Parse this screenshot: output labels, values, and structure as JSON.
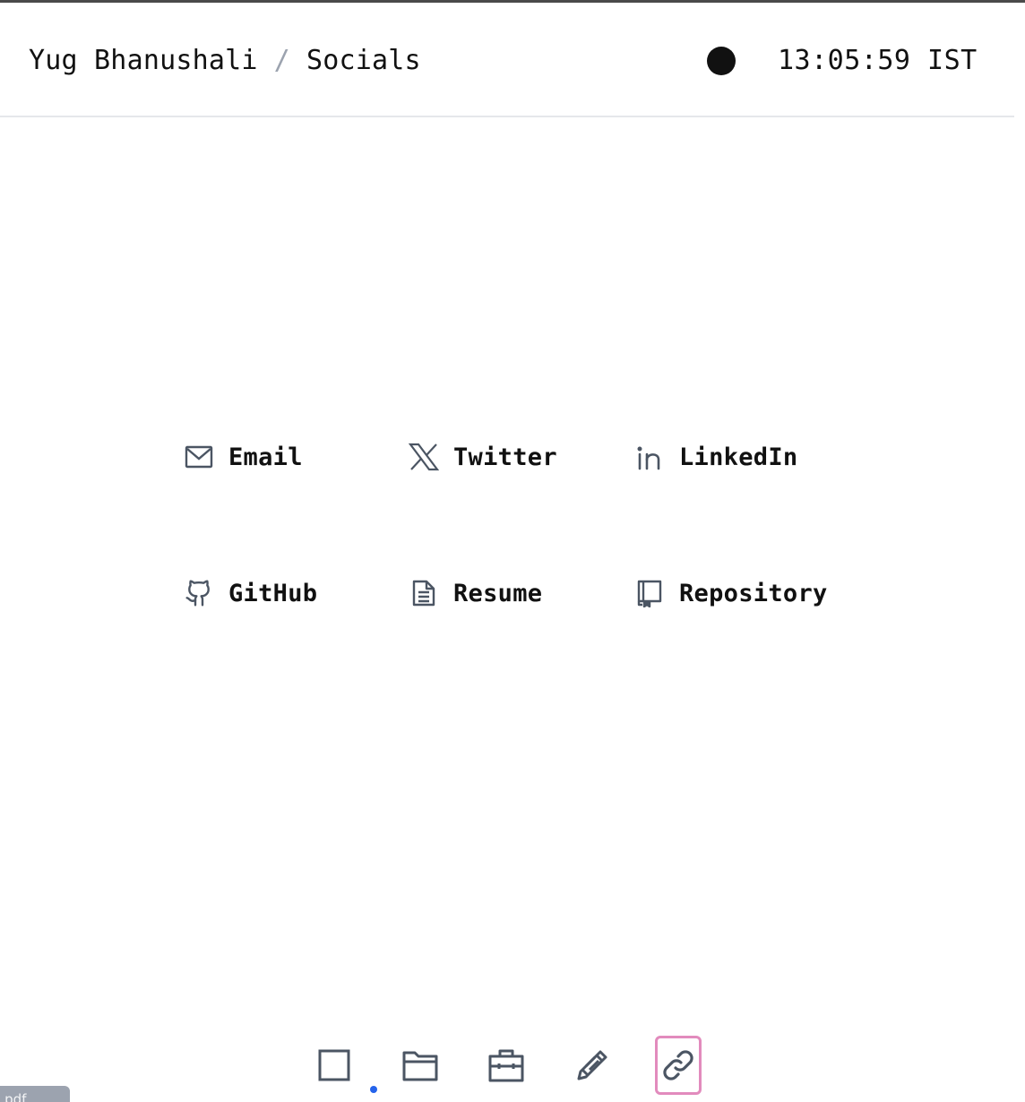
{
  "header": {
    "owner": "Yug Bhanushali",
    "separator": "/",
    "page": "Socials",
    "clock": "13:05:59 IST",
    "status_color": "#111111"
  },
  "links": [
    {
      "label": "Email",
      "icon": "mail-icon"
    },
    {
      "label": "Twitter",
      "icon": "x-logo-icon"
    },
    {
      "label": "LinkedIn",
      "icon": "linkedin-icon"
    },
    {
      "label": "GitHub",
      "icon": "github-icon"
    },
    {
      "label": "Resume",
      "icon": "document-icon"
    },
    {
      "label": "Repository",
      "icon": "repository-icon"
    }
  ],
  "dock": {
    "items": [
      {
        "icon": "square-icon",
        "active": false
      },
      {
        "icon": "folder-icon",
        "active": false
      },
      {
        "icon": "briefcase-icon",
        "active": false
      },
      {
        "icon": "pencil-icon",
        "active": false
      },
      {
        "icon": "link-icon",
        "active": true
      }
    ],
    "active_outline_color": "#e28bbd",
    "active_dot_color": "#2563eb"
  },
  "download_chip": {
    "label": "li.pdf"
  }
}
